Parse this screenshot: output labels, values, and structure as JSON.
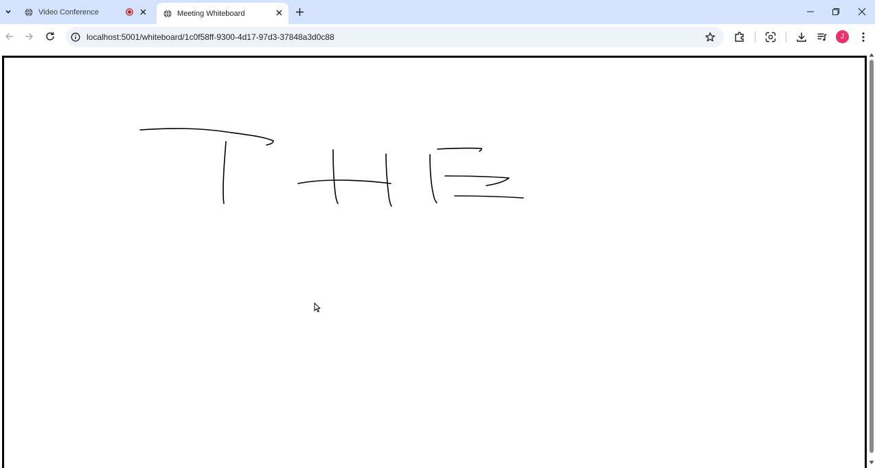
{
  "browser": {
    "tabs": [
      {
        "label": "Video Conference",
        "recording": true,
        "active": false
      },
      {
        "label": "Meeting Whiteboard",
        "active": true
      }
    ],
    "address": "localhost:5001/whiteboard/1c0f58ff-9300-4d17-97d3-37848a3d0c88",
    "profile_initial": "J",
    "colors": {
      "tabstrip": "#d3e3fd",
      "recording": "#c5221f",
      "avatar": "#e8336d",
      "omnibox": "#eef2f9"
    }
  },
  "whiteboard": {
    "strokes_color": "#000000",
    "handwritten_text": "THE"
  }
}
